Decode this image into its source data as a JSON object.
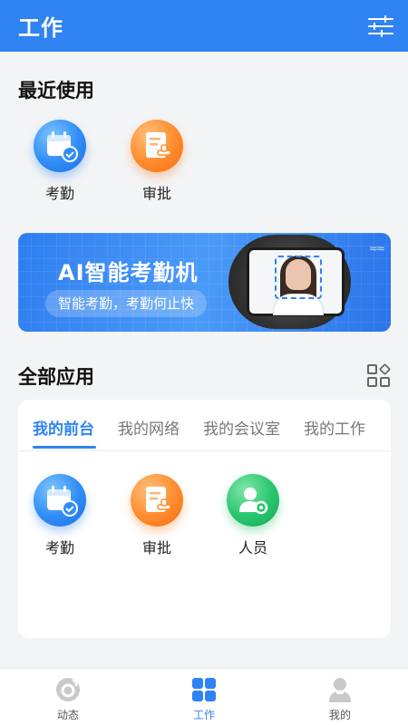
{
  "header": {
    "title": "工作",
    "filter_icon": "filter-icon"
  },
  "recent": {
    "title": "最近使用",
    "apps": [
      {
        "label": "考勤",
        "icon": "calendar-check-icon",
        "color": "#2f8cf6"
      },
      {
        "label": "审批",
        "icon": "approval-doc-icon",
        "color": "#ff8b2d"
      }
    ]
  },
  "banner": {
    "title": "AI智能考勤机",
    "subtitle": "智能考勤，考勤何止快"
  },
  "all_apps": {
    "title": "全部应用",
    "grid_icon": "app-grid-icon",
    "tabs": [
      "我的前台",
      "我的网络",
      "我的会议室",
      "我的工作"
    ],
    "active_tab": 0,
    "apps": [
      {
        "label": "考勤",
        "icon": "calendar-check-icon",
        "color": "#2f8cf6"
      },
      {
        "label": "审批",
        "icon": "approval-doc-icon",
        "color": "#ff8b2d"
      },
      {
        "label": "人员",
        "icon": "person-gear-icon",
        "color": "#28c56d"
      }
    ]
  },
  "bottom_nav": {
    "items": [
      {
        "label": "动态",
        "icon": "feed-icon"
      },
      {
        "label": "工作",
        "icon": "work-grid-icon"
      },
      {
        "label": "我的",
        "icon": "profile-icon"
      }
    ],
    "active": 1
  },
  "colors": {
    "primary": "#2f83f2",
    "background": "#f3f4f6"
  }
}
